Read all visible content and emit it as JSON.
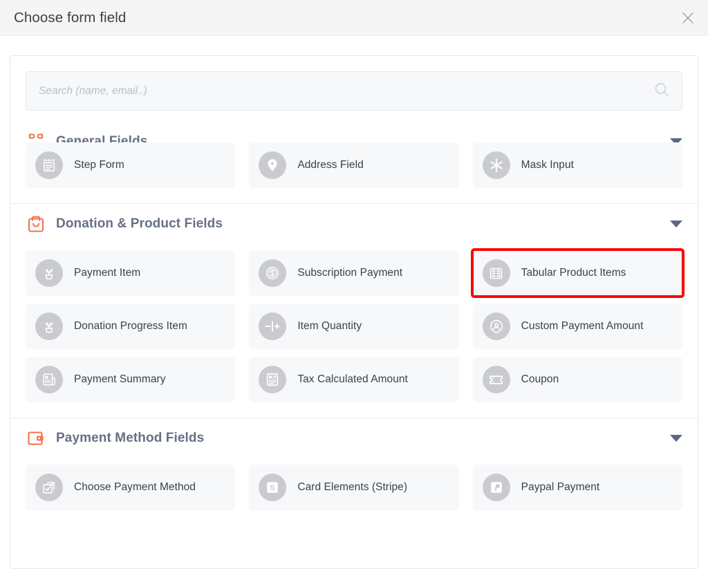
{
  "header": {
    "title": "Choose form field",
    "close_icon": "close-icon"
  },
  "search": {
    "placeholder": "Search (name, email..)",
    "value": "",
    "icon": "search-icon"
  },
  "accent_color": "#f4704a",
  "highlight_color": "#fb0606",
  "sections": [
    {
      "id": "general-fields",
      "title": "General Fields",
      "icon": "clover-icon",
      "expanded": true,
      "chevron": "chevron-down-icon",
      "clipped": true,
      "fields": [
        {
          "label": "Step Form",
          "icon": "step-form-icon",
          "highlighted": false
        },
        {
          "label": "Address Field",
          "icon": "map-pin-icon",
          "highlighted": false
        },
        {
          "label": "Mask Input",
          "icon": "asterisk-icon",
          "highlighted": false
        }
      ]
    },
    {
      "id": "donation-product-fields",
      "title": "Donation & Product Fields",
      "icon": "shopping-bag-icon",
      "expanded": true,
      "chevron": "chevron-down-icon",
      "clipped": false,
      "fields": [
        {
          "label": "Payment Item",
          "icon": "plant-icon",
          "highlighted": false
        },
        {
          "label": "Subscription Payment",
          "icon": "coin-dollar-icon",
          "highlighted": false
        },
        {
          "label": "Tabular Product Items",
          "icon": "table-grid-icon",
          "highlighted": true
        },
        {
          "label": "Donation Progress Item",
          "icon": "plant-icon",
          "highlighted": false
        },
        {
          "label": "Item Quantity",
          "icon": "minus-plus-icon",
          "highlighted": false
        },
        {
          "label": "Custom Payment Amount",
          "icon": "user-circle-icon",
          "highlighted": false
        },
        {
          "label": "Payment Summary",
          "icon": "receipt-icon",
          "highlighted": false
        },
        {
          "label": "Tax Calculated Amount",
          "icon": "document-lines-icon",
          "highlighted": false
        },
        {
          "label": "Coupon",
          "icon": "ticket-icon",
          "highlighted": false
        }
      ]
    },
    {
      "id": "payment-method-fields",
      "title": "Payment Method Fields",
      "icon": "wallet-icon",
      "expanded": true,
      "chevron": "chevron-down-icon",
      "clipped": false,
      "fields": [
        {
          "label": "Choose Payment Method",
          "icon": "checkbox-select-icon",
          "highlighted": false
        },
        {
          "label": "Card Elements (Stripe)",
          "icon": "stripe-s-icon",
          "highlighted": false
        },
        {
          "label": "Paypal Payment",
          "icon": "paypal-p-icon",
          "highlighted": false
        }
      ]
    }
  ]
}
